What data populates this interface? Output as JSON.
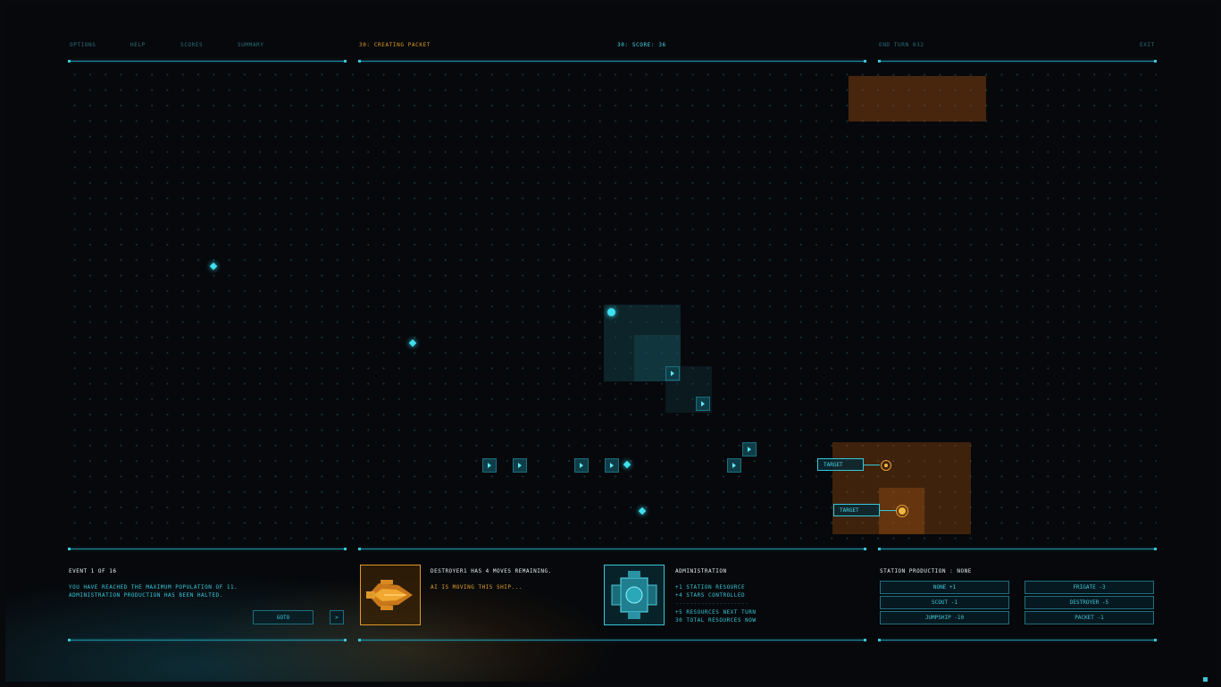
{
  "topbar": {
    "options": "OPTIONS",
    "help": "HELP",
    "scores": "SCORES",
    "summary": "SUMMARY",
    "status": "30: CREATING PACKET",
    "score": "30: SCORE: 36",
    "end_turn": "END TURN 032",
    "exit": "EXIT"
  },
  "map": {
    "targets": [
      "TARGET",
      "TARGET"
    ]
  },
  "event_panel": {
    "title": "EVENT 1 OF 16",
    "line1": "YOU HAVE REACHED THE MAXIMUM POPULATION OF 11.",
    "line2": "ADMINISTRATION PRODUCTION HAS BEEN HALTED.",
    "goto_label": "GOTO",
    "next_label": ">"
  },
  "unit_panel": {
    "line1": "DESTROYER1 HAS 4 MOVES REMAINING.",
    "line2": "AI IS MOVING THIS SHIP..."
  },
  "station_panel": {
    "title": "ADMINISTRATION",
    "line1": "+1 STATION RESOURCE",
    "line2": "+4 STARS CONTROLLED",
    "divider": "--------------------",
    "line3": "+5 RESOURCES NEXT TURN",
    "line4": "30 TOTAL RESOURCES NOW"
  },
  "production": {
    "title": "STATION PRODUCTION : NONE",
    "left": [
      "NONE +1",
      "SCOUT -1",
      "JUMPSHIP -10"
    ],
    "right": [
      "FRIGATE -3",
      "DESTROYER -5",
      "PACKET -1"
    ]
  },
  "colors": {
    "accent": "#39c6d8",
    "orange": "#e09a2a",
    "background": "#06080b"
  }
}
